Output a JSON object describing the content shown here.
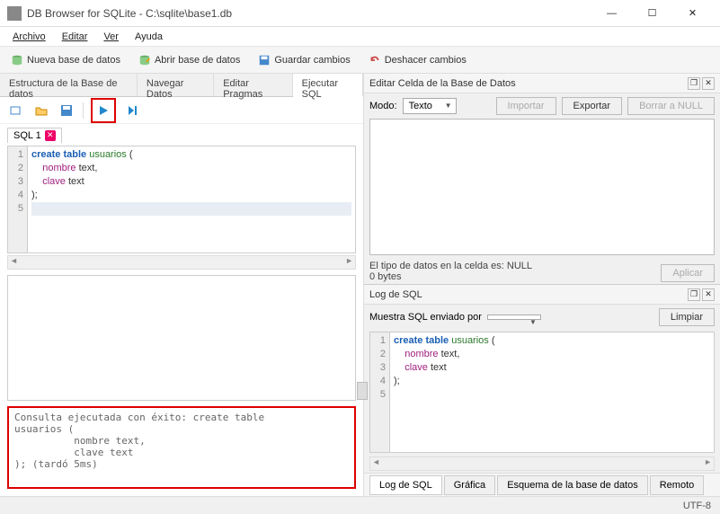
{
  "window": {
    "title": "DB Browser for SQLite - C:\\sqlite\\base1.db"
  },
  "menu": {
    "archivo": "Archivo",
    "editar": "Editar",
    "ver": "Ver",
    "ayuda": "Ayuda"
  },
  "toolbar": {
    "nueva": "Nueva base de datos",
    "abrir": "Abrir base de datos",
    "guardar": "Guardar cambios",
    "deshacer": "Deshacer cambios"
  },
  "maintabs": {
    "estructura": "Estructura de la Base de datos",
    "navegar": "Navegar Datos",
    "pragmas": "Editar Pragmas",
    "ejecutar": "Ejecutar SQL"
  },
  "sql": {
    "tab1": "SQL 1",
    "code": {
      "l1_kw": "create table ",
      "l1_id": "usuarios ",
      "l1_rest": "(",
      "l2_col": "nombre ",
      "l2_type": "text,",
      "l3_col": "clave ",
      "l3_type": "text",
      "l4": ");"
    },
    "result": "Consulta ejecutada con éxito: create table\nusuarios (\n          nombre text,\n          clave text\n); (tardó 5ms)"
  },
  "cellpanel": {
    "title": "Editar Celda de la Base de Datos",
    "modo_label": "Modo:",
    "modo_value": "Texto",
    "importar": "Importar",
    "exportar": "Exportar",
    "borrar": "Borrar a NULL",
    "info1": "El tipo de datos en la celda es: NULL",
    "info2": "0 bytes",
    "aplicar": "Aplicar"
  },
  "logpanel": {
    "title": "Log de SQL",
    "label": "Muestra SQL enviado por",
    "combo_value": "",
    "limpiar": "Limpiar"
  },
  "bottomtabs": {
    "log": "Log de SQL",
    "grafica": "Gráfica",
    "esquema": "Esquema de la base de datos",
    "remoto": "Remoto"
  },
  "status": {
    "encoding": "UTF-8"
  },
  "gutter": [
    "1",
    "2",
    "3",
    "4",
    "5"
  ]
}
